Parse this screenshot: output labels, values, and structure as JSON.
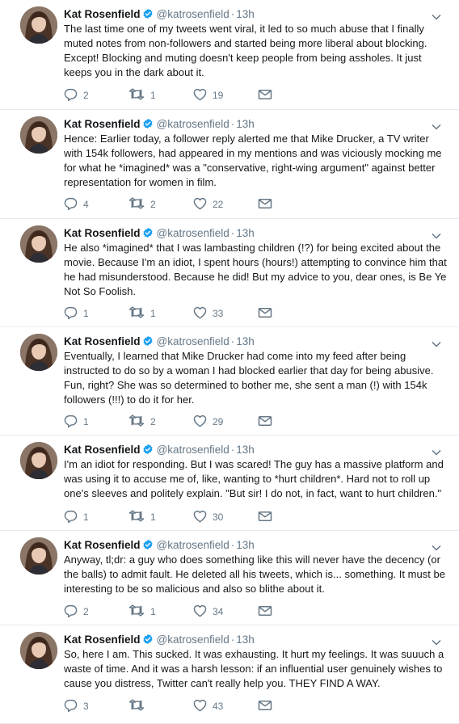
{
  "colors": {
    "name": "#14171a",
    "muted": "#657786",
    "verified": "#1da1f2",
    "divider": "#e6ecf0"
  },
  "icons": {
    "reply": "reply-icon",
    "retweet": "retweet-icon",
    "like": "heart-icon",
    "dm": "mail-icon",
    "menu": "chevron-down-icon",
    "badge": "verified-badge-icon"
  },
  "tweets": [
    {
      "name": "Kat Rosenfield",
      "handle": "@katrosenfield",
      "sep": "·",
      "time": "13h",
      "text": "The last time one of my tweets went viral, it led to so much abuse that I finally muted notes from non-followers and started being more liberal about blocking. Except! Blocking and muting doesn't keep people from being assholes. It just keeps you in the dark about it.",
      "replies": "2",
      "retweets": "1",
      "likes": "19"
    },
    {
      "name": "Kat Rosenfield",
      "handle": "@katrosenfield",
      "sep": "·",
      "time": "13h",
      "text": "Hence: Earlier today, a follower reply alerted me that Mike Drucker, a TV writer with 154k followers, had appeared in my mentions and was viciously mocking me for what he *imagined* was a \"conservative, right-wing argument\" against better representation for women in film.",
      "replies": "4",
      "retweets": "2",
      "likes": "22"
    },
    {
      "name": "Kat Rosenfield",
      "handle": "@katrosenfield",
      "sep": "·",
      "time": "13h",
      "text": "He also *imagined* that I was lambasting children (!?) for being excited about the movie. Because I'm an idiot, I spent hours (hours!) attempting to convince him that he had misunderstood. Because he did! But my advice to you, dear ones, is Be Ye Not So Foolish.",
      "replies": "1",
      "retweets": "1",
      "likes": "33"
    },
    {
      "name": "Kat Rosenfield",
      "handle": "@katrosenfield",
      "sep": "·",
      "time": "13h",
      "text": "Eventually, I learned that Mike Drucker had come into my feed after being instructed to do so by a woman I had blocked earlier that day for being abusive. Fun, right? She was so determined to bother me, she sent a man (!) with 154k followers (!!!) to do it for her.",
      "replies": "1",
      "retweets": "2",
      "likes": "29"
    },
    {
      "name": "Kat Rosenfield",
      "handle": "@katrosenfield",
      "sep": "·",
      "time": "13h",
      "text": "I'm an idiot for responding. But I was scared! The guy has a massive platform and was using it to accuse me of, like, wanting to *hurt children*. Hard not to roll up one's sleeves and politely explain. \"But sir! I do not, in fact, want to hurt children.\"",
      "replies": "1",
      "retweets": "1",
      "likes": "30"
    },
    {
      "name": "Kat Rosenfield",
      "handle": "@katrosenfield",
      "sep": "·",
      "time": "13h",
      "text": "Anyway, tl;dr: a guy who does something like this will never have the decency (or the balls) to admit fault. He deleted all his tweets, which is... something. It must be interesting to be so malicious and also so blithe about it.",
      "replies": "2",
      "retweets": "1",
      "likes": "34"
    },
    {
      "name": "Kat Rosenfield",
      "handle": "@katrosenfield",
      "sep": "·",
      "time": "13h",
      "text": "So, here I am. This sucked. It was exhausting. It hurt my feelings. It was suuuch a waste of time. And it was a harsh lesson: if an influential user genuinely wishes to cause you distress, Twitter can't really help you. THEY FIND A WAY.",
      "replies": "3",
      "retweets": "",
      "likes": "43"
    }
  ]
}
